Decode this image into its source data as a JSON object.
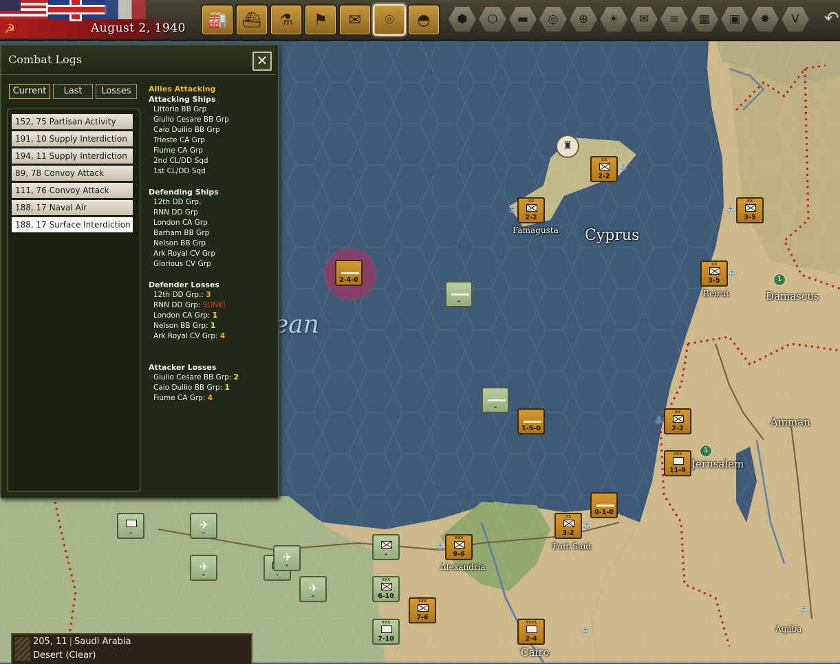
{
  "date": "August 2, 1940",
  "combat_logs": {
    "title": "Combat Logs",
    "close_symbol": "✕",
    "tabs": [
      "Current",
      "Last",
      "Losses"
    ],
    "active_tab": "Current",
    "entries": [
      "152, 75 Partisan Activity",
      "191, 10 Supply Interdiction",
      "194, 11 Supply Interdiction",
      "89, 78 Convoy Attack",
      "111, 76 Convoy Attack",
      "188, 17 Naval Air Interdiction",
      "188, 17 Surface Interdiction"
    ],
    "selected_entry": "188, 17 Surface Interdiction",
    "details": {
      "attacker_side": "Allies Attacking",
      "attacking_header": "Attacking Ships",
      "attacking_ships": [
        "Littorio BB Grp",
        "Giulio Cesare BB Grp",
        "Caio Duilio BB Grp",
        "Trieste CA Grp",
        "Fiume CA Grp",
        "2nd CL/DD Sqd",
        "1st CL/DD Sqd"
      ],
      "defending_header": "Defending Ships",
      "defending_ships": [
        "12th DD Grp.",
        "RNN DD Grp",
        "London CA Grp",
        "Barham BB Grp",
        "Nelson BB Grp",
        "Ark Royal CV Grp",
        "Glorious CV Grp"
      ],
      "defender_losses_header": "Defender Losses",
      "defender_losses": [
        {
          "name": "12th DD Grp.:",
          "value": "3"
        },
        {
          "name": "RNN DD Grp:",
          "value": "SUNK!"
        },
        {
          "name": "London CA Grp:",
          "value": "1"
        },
        {
          "name": "Nelson BB Grp:",
          "value": "1"
        },
        {
          "name": "Ark Royal CV Grp:",
          "value": "4"
        }
      ],
      "attacker_losses_header": "Attacker Losses",
      "attacker_losses": [
        {
          "name": "Giulio Cesare BB Grp:",
          "value": "2"
        },
        {
          "name": "Caio Duilio BB Grp:",
          "value": "1"
        },
        {
          "name": "Fiume CA Grp:",
          "value": "4"
        }
      ]
    }
  },
  "map_labels": {
    "cyprus": "Cyprus",
    "famagusta": "Famagusta",
    "beirut": "Beirut",
    "damascus": "Damascus",
    "amman": "Amman",
    "jerusalem": "Jerusalem",
    "alexandria": "Alexandria",
    "port_said": "Port Said",
    "cairo": "Cairo",
    "aqaba": "Aqaba",
    "sea_fragment": "ean"
  },
  "units": {
    "u1": {
      "size": "xx",
      "str": "2-2"
    },
    "u2": {
      "size": "xx",
      "str": "2-2"
    },
    "u3": {
      "size": "xx",
      "str": "3-5"
    },
    "u4": {
      "size": "xx",
      "str": "3-5"
    },
    "u5": {
      "size": "",
      "str": "2-4-0"
    },
    "u6": {
      "size": "",
      "str": "-"
    },
    "u7": {
      "size": "",
      "str": "-"
    },
    "u8": {
      "size": "",
      "str": "1-5-0"
    },
    "u9": {
      "size": "xx",
      "str": "2-2"
    },
    "u10": {
      "size": "xxx",
      "str": "11-9"
    },
    "u11": {
      "size": "",
      "str": "0-1-0"
    },
    "u12": {
      "size": "xx",
      "str": "3-2"
    },
    "u13": {
      "size": "xxx",
      "str": "9-6"
    },
    "u14": {
      "size": "",
      "str": "-"
    },
    "u15": {
      "size": "xxx",
      "str": "6-10"
    },
    "u16": {
      "size": "xxx",
      "str": "7-10"
    },
    "u17": {
      "size": "xxx",
      "str": "7-6"
    },
    "u18": {
      "size": "xxxx",
      "str": "2-4"
    },
    "u19": {
      "size": "",
      "str": "-"
    },
    "u20": {
      "size": "",
      "str": "-"
    },
    "u21": {
      "size": "",
      "str": "-"
    },
    "u22": {
      "size": "",
      "str": "-"
    },
    "u23": {
      "size": "",
      "str": "-"
    },
    "u24": {
      "size": "",
      "str": "-"
    }
  },
  "victory_points": {
    "damascus": "1",
    "jerusalem": "1"
  },
  "hex_info": {
    "coords": "205, 11",
    "region": "Saudi Arabia",
    "terrain": "Desert (Clear)"
  },
  "toolbar": {
    "buttons": [
      "production",
      "naval",
      "research",
      "diplomacy",
      "reports",
      "intelligence",
      "military"
    ],
    "active": "intelligence",
    "filters": [
      "hex-grid",
      "hex-cluster",
      "tank",
      "resources",
      "target",
      "weather",
      "envelope",
      "ships",
      "grid",
      "frame",
      "explosion",
      "victory"
    ]
  },
  "colors": {
    "axis_unit": "#c98d24",
    "allied_unit": "#a9c191",
    "sea": "#3e5a78",
    "desert": "#cdb98a",
    "accent": "#f2b72c"
  }
}
